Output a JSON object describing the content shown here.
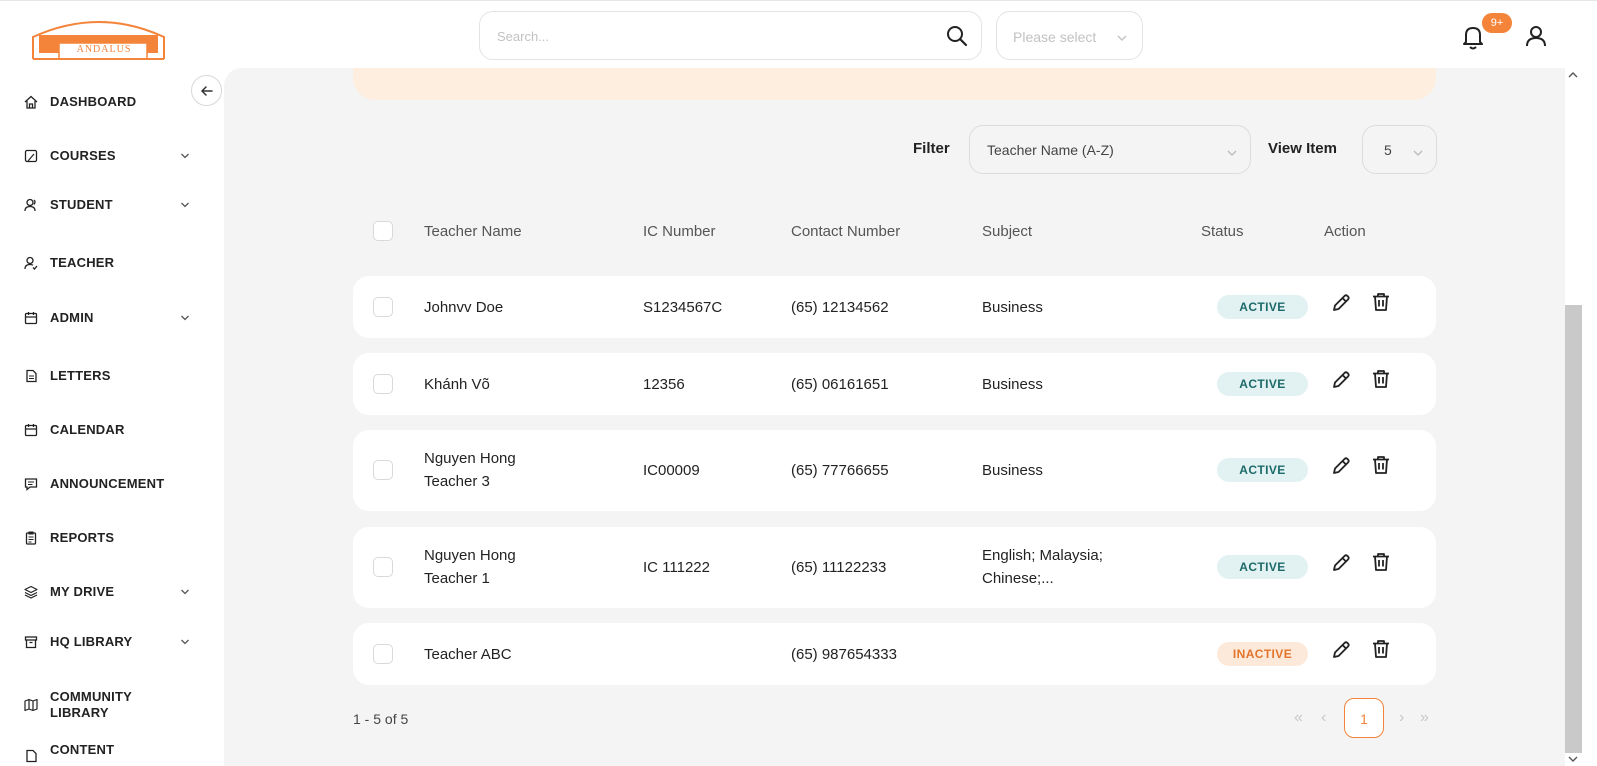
{
  "header": {
    "logo_text": "ANDALUS",
    "search_placeholder": "Search...",
    "select_placeholder": "Please select",
    "notification_badge": "9+"
  },
  "sidebar": {
    "items": [
      {
        "label": "DASHBOARD",
        "icon": "home-icon",
        "expandable": false
      },
      {
        "label": "COURSES",
        "icon": "book-icon",
        "expandable": true
      },
      {
        "label": "STUDENT",
        "icon": "users-icon",
        "expandable": true
      },
      {
        "label": "TEACHER",
        "icon": "user-check-icon",
        "expandable": false
      },
      {
        "label": "ADMIN",
        "icon": "calendar-icon",
        "expandable": true
      },
      {
        "label": "LETTERS",
        "icon": "file-icon",
        "expandable": false
      },
      {
        "label": "CALENDAR",
        "icon": "calendar-icon",
        "expandable": false
      },
      {
        "label": "ANNOUNCEMENT",
        "icon": "message-icon",
        "expandable": false
      },
      {
        "label": "REPORTS",
        "icon": "clipboard-icon",
        "expandable": false
      },
      {
        "label": "MY DRIVE",
        "icon": "layers-icon",
        "expandable": true
      },
      {
        "label": "HQ LIBRARY",
        "icon": "archive-icon",
        "expandable": true
      },
      {
        "label": "COMMUNITY LIBRARY",
        "label_line1": "COMMUNITY",
        "label_line2": "LIBRARY",
        "icon": "map-icon",
        "expandable": false
      },
      {
        "label": "CONTENT",
        "icon": "content-icon",
        "expandable": false
      }
    ]
  },
  "toolbar": {
    "filter_label": "Filter",
    "filter_value": "Teacher Name (A-Z)",
    "view_label": "View Item",
    "view_value": "5"
  },
  "table": {
    "columns": [
      "Teacher Name",
      "IC Number",
      "Contact Number",
      "Subject",
      "Status",
      "Action"
    ],
    "rows": [
      {
        "name_line1": "Johnvv Doe",
        "name_line2": "",
        "ic": "S1234567C",
        "contact": "(65) 12134562",
        "subject_line1": "Business",
        "subject_line2": "",
        "status": "ACTIVE"
      },
      {
        "name_line1": "Khánh Võ",
        "name_line2": "",
        "ic": "12356",
        "contact": "(65) 06161651",
        "subject_line1": "Business",
        "subject_line2": "",
        "status": "ACTIVE"
      },
      {
        "name_line1": "Nguyen Hong",
        "name_line2": "Teacher 3",
        "ic": "IC00009",
        "contact": "(65) 77766655",
        "subject_line1": "Business",
        "subject_line2": "",
        "status": "ACTIVE"
      },
      {
        "name_line1": "Nguyen Hong",
        "name_line2": "Teacher 1",
        "ic": "IC 111222",
        "contact": "(65) 11122233",
        "subject_line1": "English; Malaysia;",
        "subject_line2": "Chinese;...",
        "status": "ACTIVE"
      },
      {
        "name_line1": "Teacher ABC",
        "name_line2": "",
        "ic": "",
        "contact": "(65) 987654333",
        "subject_line1": "",
        "subject_line2": "",
        "status": "INACTIVE"
      }
    ]
  },
  "pagination": {
    "range": "1 - 5 of 5",
    "first": "«",
    "prev": "‹",
    "current": "1",
    "next": "›",
    "last": "»"
  },
  "colors": {
    "accent": "#f3843a",
    "active_bg": "#e2f1f1",
    "active_text": "#1d6a6a",
    "inactive_bg": "#fde9da",
    "inactive_text": "#e2742c"
  }
}
